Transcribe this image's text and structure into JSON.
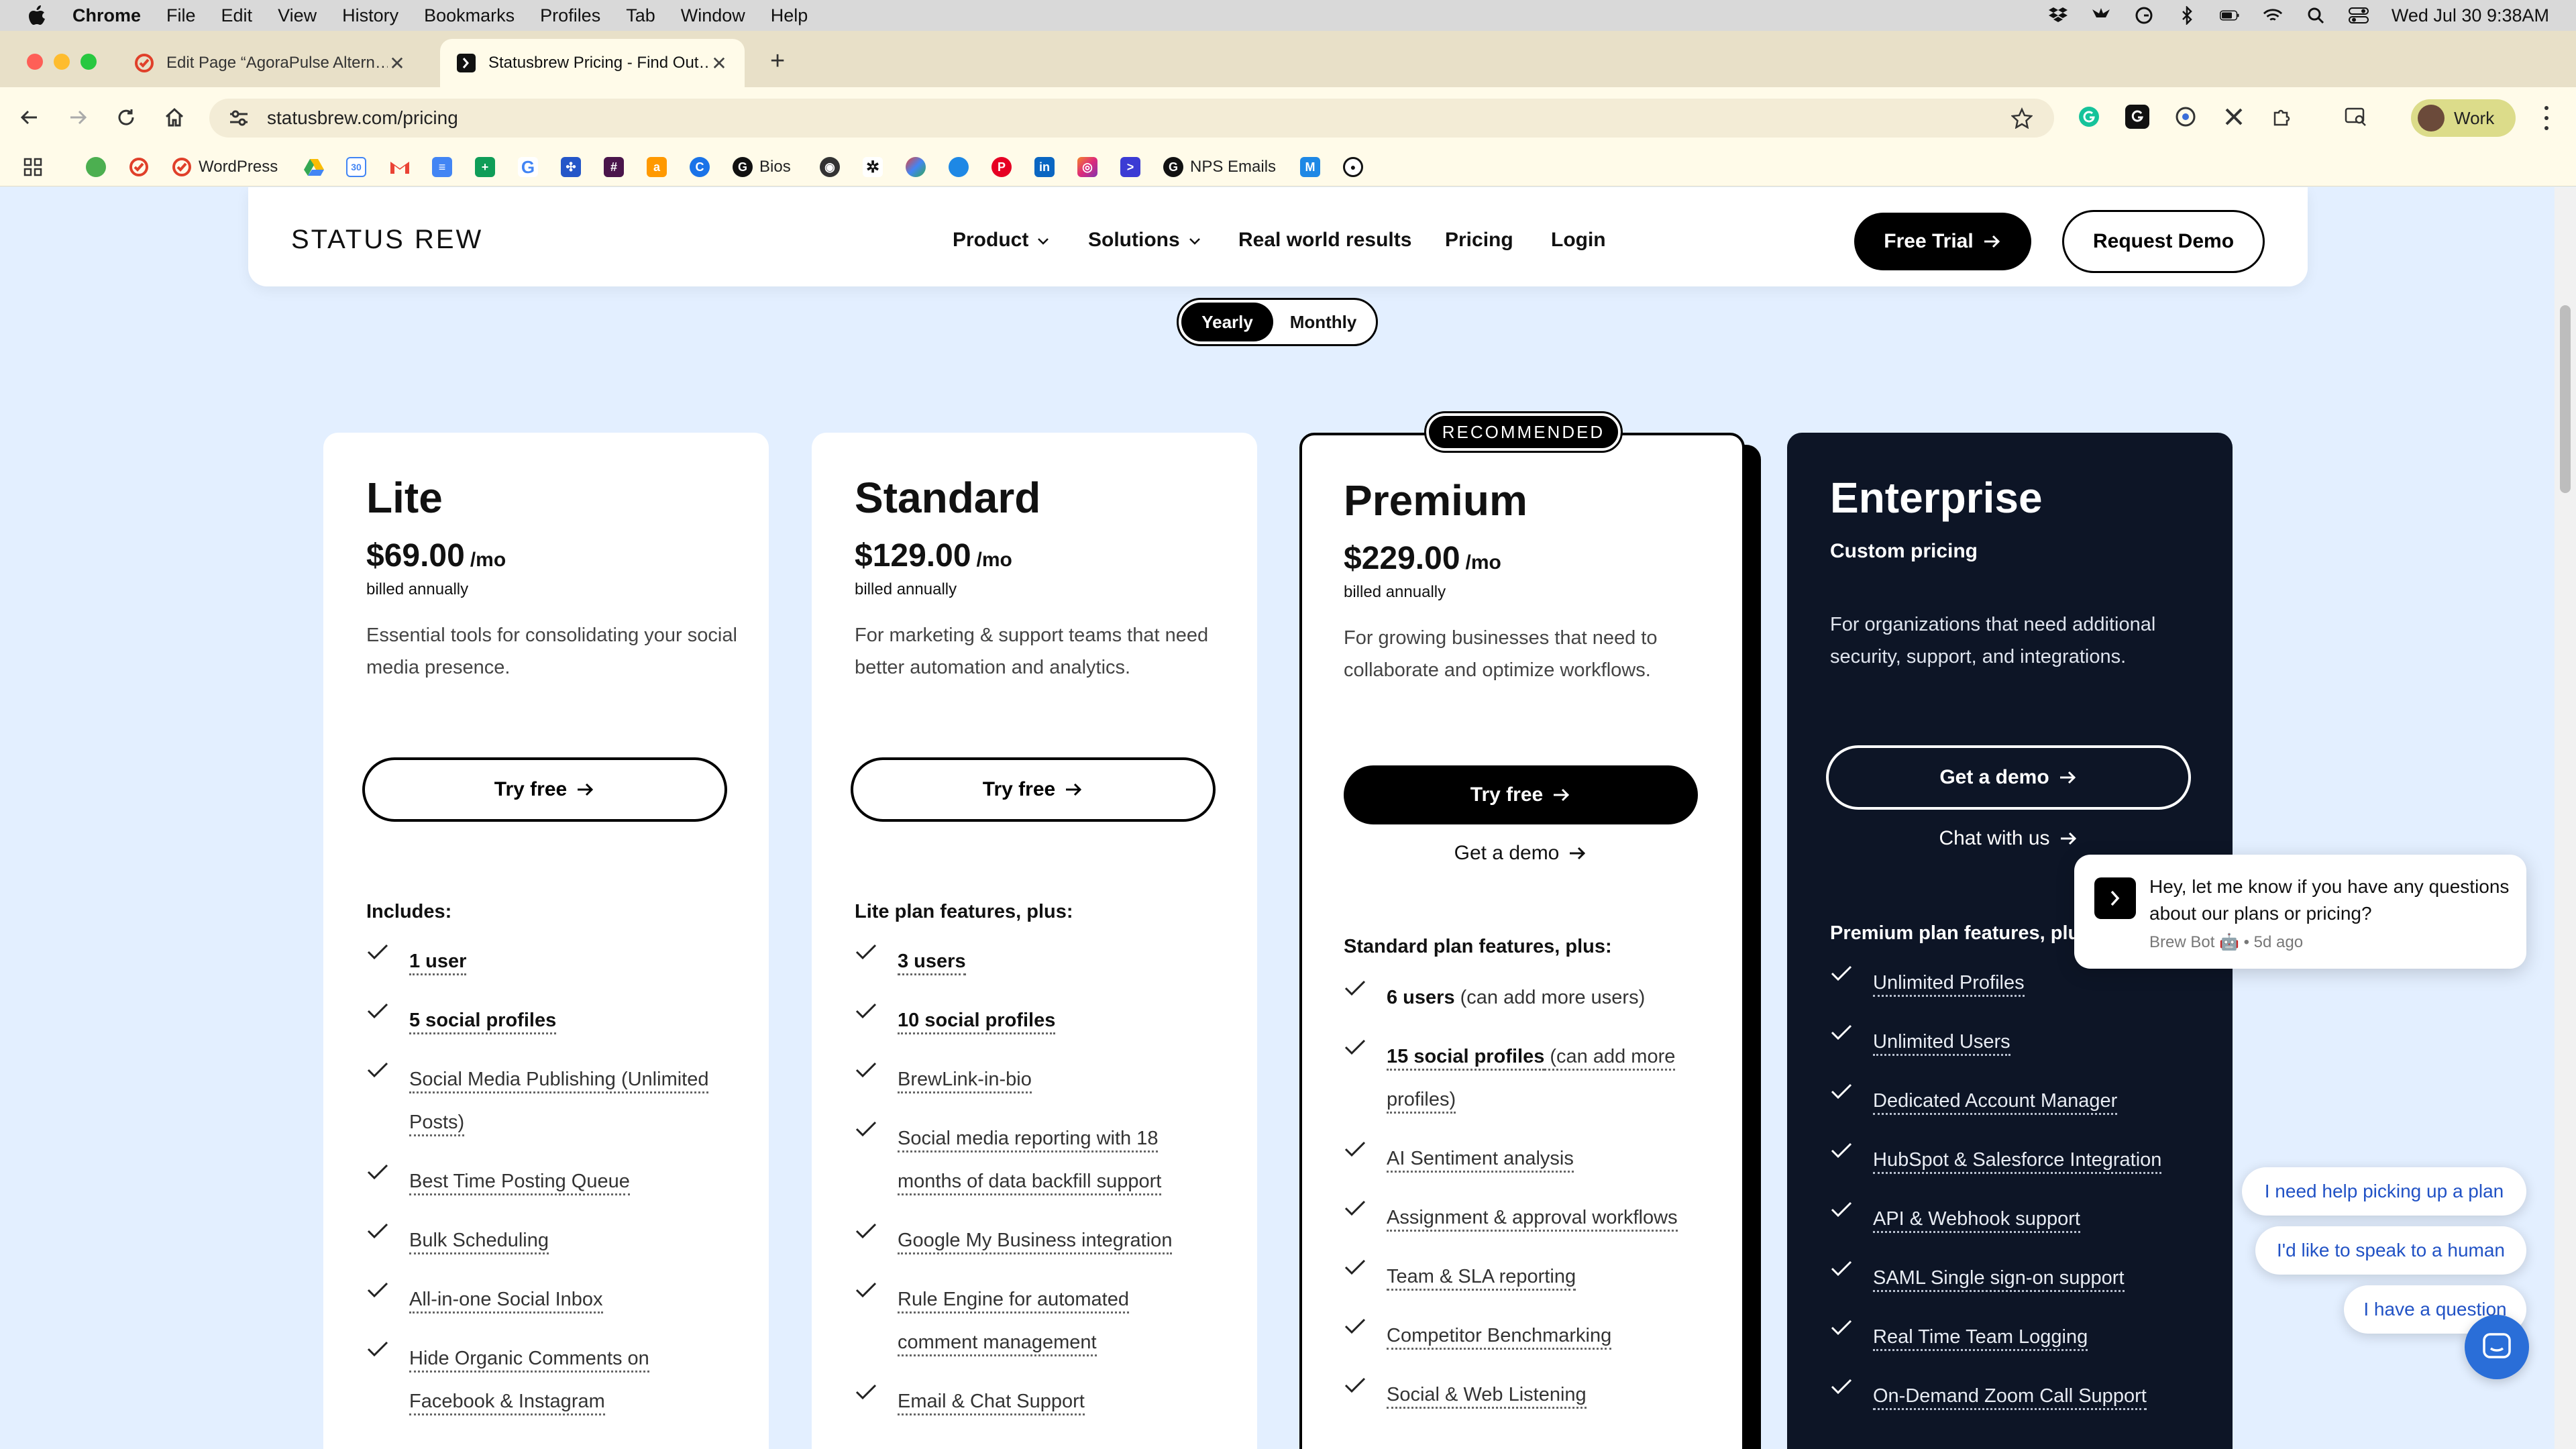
{
  "menubar": {
    "app": "Chrome",
    "items": [
      "File",
      "Edit",
      "View",
      "History",
      "Bookmarks",
      "Profiles",
      "Tab",
      "Window",
      "Help"
    ],
    "clock": "Wed Jul 30  9:38AM"
  },
  "tabs": [
    {
      "label": "Edit Page “AgoraPulse Altern…",
      "icon": "edit-page-icon"
    },
    {
      "label": "Statusbrew Pricing - Find Out…",
      "icon": "statusbrew-icon"
    }
  ],
  "toolbar": {
    "url": "statusbrew.com/pricing",
    "profile_label": "Work"
  },
  "bookmarks": {
    "wordpress": "WordPress",
    "bios": "Bios",
    "nps": "NPS Emails"
  },
  "site": {
    "logo": "STATUS REW",
    "nav": {
      "product": "Product",
      "solutions": "Solutions",
      "results": "Real world results",
      "pricing": "Pricing",
      "login": "Login"
    },
    "free_trial": "Free Trial",
    "request_demo": "Request Demo"
  },
  "billing_toggle": {
    "yearly": "Yearly",
    "monthly": "Monthly",
    "selected": "Yearly"
  },
  "plans": {
    "lite": {
      "name": "Lite",
      "price": "$69.00",
      "per": "/mo",
      "billed": "billed annually",
      "desc": "Essential tools for consolidating your social media presence.",
      "cta": "Try free",
      "features_title": "Includes:",
      "features": [
        "1 user",
        "5 social profiles",
        "Social Media Publishing (Unlimited Posts)",
        "Best Time Posting Queue",
        "Bulk Scheduling",
        "All-in-one Social Inbox",
        "Hide Organic Comments on Facebook & Instagram"
      ]
    },
    "standard": {
      "name": "Standard",
      "price": "$129.00",
      "per": "/mo",
      "billed": "billed annually",
      "desc": "For marketing & support teams that need better automation and analytics.",
      "cta": "Try free",
      "features_title": "Lite plan features, plus:",
      "features": [
        "3 users",
        "10 social profiles",
        "BrewLink-in-bio",
        "Social media reporting with 18 months of data backfill support",
        "Google My Business integration",
        "Rule Engine for automated comment management",
        "Email & Chat Support"
      ]
    },
    "premium": {
      "badge": "RECOMMENDED",
      "name": "Premium",
      "price": "$229.00",
      "per": "/mo",
      "billed": "billed annually",
      "desc": "For growing businesses that need to collaborate and optimize workflows.",
      "cta": "Try free",
      "secondary": "Get a demo",
      "features_title": "Standard plan features, plus:",
      "features": [
        {
          "main": "6 users",
          "extra": " (can add more users)"
        },
        {
          "main": "15 social profiles",
          "extra": " (can add more profiles)"
        },
        {
          "main": "AI Sentiment analysis",
          "extra": ""
        },
        {
          "main": "Assignment & approval workflows",
          "extra": ""
        },
        {
          "main": "Team & SLA reporting",
          "extra": ""
        },
        {
          "main": "Competitor Benchmarking",
          "extra": ""
        },
        {
          "main": "Social & Web Listening",
          "extra": ""
        }
      ]
    },
    "enterprise": {
      "name": "Enterprise",
      "price_label": "Custom pricing",
      "desc": "For organizations that need additional security, support, and integrations.",
      "cta": "Get a demo",
      "secondary": "Chat with us",
      "features_title": "Premium plan features, plus:",
      "features": [
        "Unlimited Profiles",
        "Unlimited Users",
        "Dedicated Account Manager",
        "HubSpot & Salesforce Integration",
        "API & Webhook support",
        "SAML Single sign-on support",
        "Real Time Team Logging",
        "On-Demand Zoom Call Support"
      ]
    }
  },
  "chat": {
    "message": "Hey, let me know if you have any questions about our plans or pricing?",
    "meta": "Brew Bot 🤖 • 5d ago",
    "replies": [
      "I need help picking up a plan",
      "I'd like to speak to a human",
      "I have a question"
    ]
  }
}
